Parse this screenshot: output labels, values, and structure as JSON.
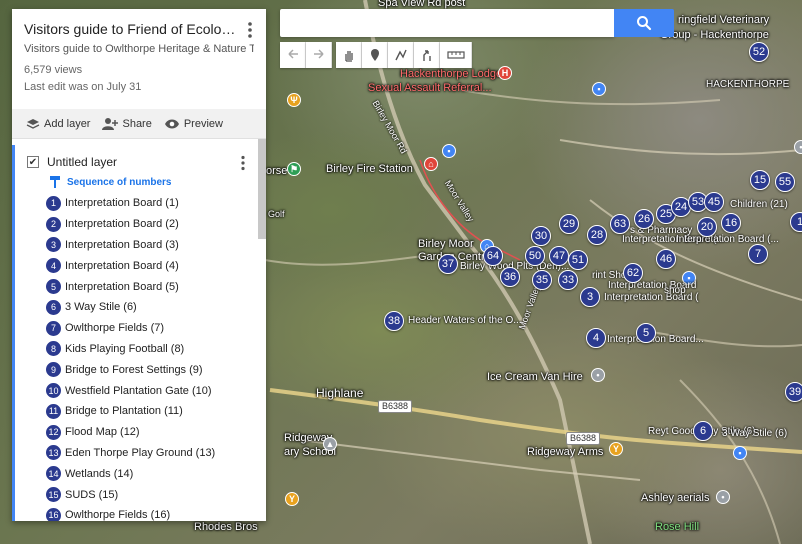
{
  "search": {
    "value": "",
    "placeholder": ""
  },
  "toolbar": {
    "undo": "undo-icon",
    "redo": "redo-icon",
    "pan": "hand-icon",
    "marker": "marker-icon",
    "line": "line-icon",
    "directions": "directions-icon",
    "measure": "ruler-icon"
  },
  "panel": {
    "title": "Visitors guide to Friend of Ecologi...",
    "description": "Visitors guide to Owlthorpe Heritage & Nature Trail",
    "views": "6,579 views",
    "last_edit": "Last edit was on July 31",
    "actions": {
      "add_layer": "Add layer",
      "share": "Share",
      "preview": "Preview"
    },
    "layer": {
      "name": "Untitled layer",
      "checked": true,
      "style": "Sequence of numbers",
      "items": [
        {
          "n": "1",
          "label": "Interpretation Board (1)"
        },
        {
          "n": "2",
          "label": "Interpretation Board (2)"
        },
        {
          "n": "3",
          "label": "Interpretation Board (3)"
        },
        {
          "n": "4",
          "label": "Interpretation Board (4)"
        },
        {
          "n": "5",
          "label": "Interpretation Board (5)"
        },
        {
          "n": "6",
          "label": "3 Way Stile (6)"
        },
        {
          "n": "7",
          "label": "Owlthorpe Fields (7)"
        },
        {
          "n": "8",
          "label": "Kids Playing Football (8)"
        },
        {
          "n": "9",
          "label": "Bridge to Forest Settings (9)"
        },
        {
          "n": "10",
          "label": "Westfield Plantation Gate (10)"
        },
        {
          "n": "11",
          "label": "Bridge to Plantation (11)"
        },
        {
          "n": "12",
          "label": "Flood Map (12)"
        },
        {
          "n": "13",
          "label": "Eden Thorpe Play Ground (13)"
        },
        {
          "n": "14",
          "label": "Wetlands (14)"
        },
        {
          "n": "15",
          "label": "SUDS (15)"
        },
        {
          "n": "16",
          "label": "Owlthorpe Fields (16)"
        }
      ]
    }
  },
  "map": {
    "places": [
      {
        "text": "Spa View Rd post"
      },
      {
        "text": "ringfield Veterinary"
      },
      {
        "text": "Group - Hackenthorpe"
      },
      {
        "text": "Hackenthorpe Lodge"
      },
      {
        "text": "Sexual Assault Referral..."
      },
      {
        "text": "HACKENTHORPE"
      },
      {
        "text": "Birley Fire Station"
      },
      {
        "text": "Birley Moor"
      },
      {
        "text": "Garden Centre"
      },
      {
        "text": "Ice Cream Van Hire"
      },
      {
        "text": "Highlane"
      },
      {
        "text": "Ridgeway"
      },
      {
        "text": "ary School"
      },
      {
        "text": "Ridgeway Arms"
      },
      {
        "text": "Ashley aerials"
      },
      {
        "text": "Rose Hill"
      },
      {
        "text": "Rhodes Bros"
      },
      {
        "text": "orse"
      },
      {
        "text": "Golf"
      }
    ],
    "roads": [
      {
        "text": "Birley Moor Rd"
      },
      {
        "text": "Moor Valley"
      },
      {
        "text": "Moor Valley"
      }
    ],
    "shields": [
      "B6388",
      "B6388"
    ],
    "pin_labels": [
      "Header Waters of the O...",
      "Interpretation Board (...",
      "Interpretation Board...",
      "Interpretation Board (",
      "Interpretation Board",
      "Birley Wood Plts (Den)...",
      "Interpretation Board (...",
      "Reyt Good Way Stile (6)",
      "3 Way Stile (6)",
      "Children (21)",
      "shop",
      "rint Shop",
      "s & Pharmacy"
    ],
    "pins": [
      "52",
      "15",
      "55",
      "29",
      "26",
      "25",
      "24",
      "53",
      "45",
      "20",
      "16",
      "63",
      "28",
      "30",
      "47",
      "51",
      "64",
      "50",
      "35",
      "33",
      "36",
      "37",
      "62",
      "46",
      "3",
      "38",
      "4",
      "5",
      "6",
      "7",
      "39",
      "1"
    ],
    "accent": "#4285f4",
    "pin_color": "#2b3a8f"
  }
}
